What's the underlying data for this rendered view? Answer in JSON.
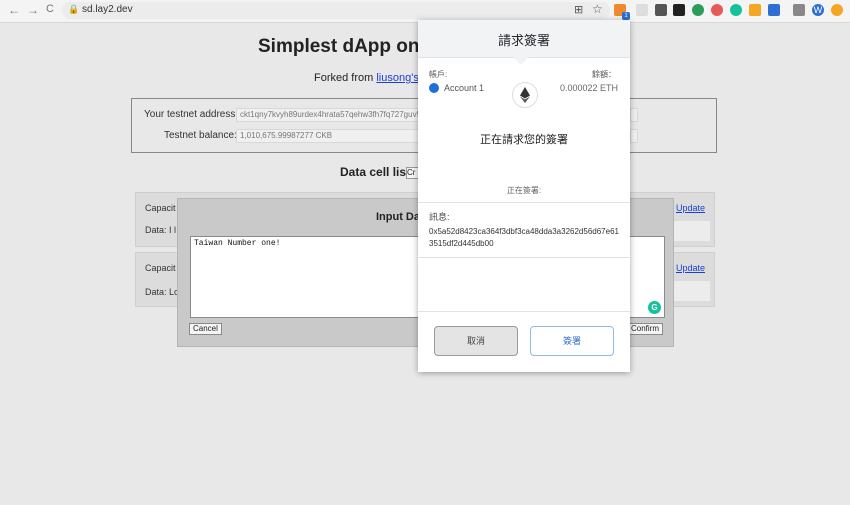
{
  "browser": {
    "url": "sd.lay2.dev",
    "nav_back": "←",
    "nav_forward": "→",
    "nav_reload": "C",
    "lock": "🔒",
    "translate": "⊞",
    "star": "☆",
    "metamask_badge": "1",
    "ext_w": "W"
  },
  "page": {
    "title": "Simplest dApp on",
    "forked_prefix": "Forked from",
    "forked_link": "liusong's w",
    "testnet_address_label": "Your testnet address:",
    "testnet_address_value": "ckt1qny7kvyh89urdex4hrata57qehw3fh7fq727guv5",
    "testnet_balance_label": "Testnet balance:",
    "testnet_balance_value": "1,010,675.99987277 CKB",
    "data_cell_list_title": "Data cell list",
    "data_cell_list_button": "Cr",
    "cells": [
      {
        "capacity": "Capacit",
        "data": "Data: I l",
        "update": "Update"
      },
      {
        "capacity": "Capacit",
        "data": "Data: Lo",
        "update": "Update"
      }
    ]
  },
  "modal": {
    "title": "Input Da",
    "textarea_value": "Taiwan Number one!",
    "cancel": "Cancel",
    "confirm": "Confirm",
    "grammarly": "G"
  },
  "metamask": {
    "title": "請求簽署",
    "account_label": "帳戶:",
    "account_name": "Account 1",
    "balance_label": "餘額：",
    "balance_value": "0.000022 ETH",
    "eth_icon": "◆",
    "request_text": "正在請求您的簽署",
    "signing_label": "正在簽署:",
    "message_label": "訊息:",
    "message_value": "0x5a52d8423ca364f3dbf3ca48dda3a3262d56d67e613515df2d445db00",
    "cancel": "取消",
    "sign": "簽署"
  }
}
